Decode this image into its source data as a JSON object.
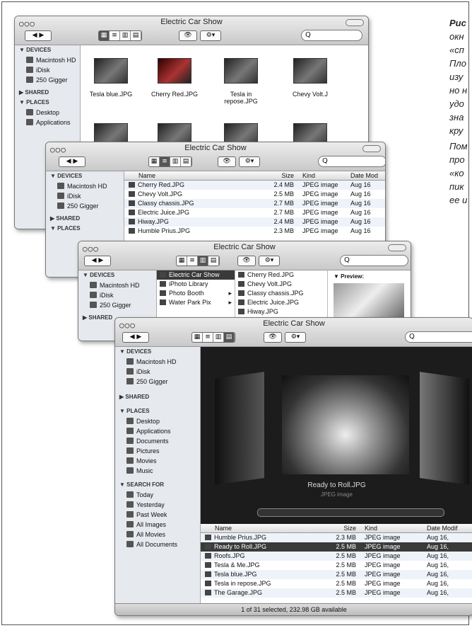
{
  "caption": {
    "lines": [
      "Рис",
      "окн",
      "«сп",
      "Пло",
      "изу",
      "но н",
      "удо",
      "зна",
      "кру",
      "Пом",
      "про",
      "«ко",
      "пик",
      "ее и"
    ]
  },
  "window_title": "Electric Car Show",
  "search_placeholder": "Q",
  "sidebar": {
    "devices_header": "▼ DEVICES",
    "devices": [
      "Macintosh HD",
      "iDisk",
      "250 Gigger"
    ],
    "shared_header": "▶ SHARED",
    "places_header": "▼ PLACES",
    "places": [
      "Desktop",
      "Applications",
      "Documents",
      "Pictures",
      "Movies",
      "Music"
    ],
    "search_header": "▼ SEARCH FOR",
    "searches": [
      "Today",
      "Yesterday",
      "Past Week",
      "All Images",
      "All Movies",
      "All Documents"
    ]
  },
  "icon_view": {
    "items": [
      "Tesla blue.JPG",
      "Cherry Red.JPG",
      "Tesla in repose.JPG",
      "Chevy Volt.J"
    ]
  },
  "list_view": {
    "headers": {
      "name": "Name",
      "size": "Size",
      "kind": "Kind",
      "date": "Date Mod"
    },
    "rows": [
      {
        "name": "Cherry Red.JPG",
        "size": "2.4 MB",
        "kind": "JPEG image",
        "date": "Aug 16"
      },
      {
        "name": "Chevy Volt.JPG",
        "size": "2.5 MB",
        "kind": "JPEG image",
        "date": "Aug 16"
      },
      {
        "name": "Classy chassis.JPG",
        "size": "2.7 MB",
        "kind": "JPEG image",
        "date": "Aug 16"
      },
      {
        "name": "Electric Juice.JPG",
        "size": "2.7 MB",
        "kind": "JPEG image",
        "date": "Aug 16"
      },
      {
        "name": "Hiway.JPG",
        "size": "2.4 MB",
        "kind": "JPEG image",
        "date": "Aug 16"
      },
      {
        "name": "Humble Prius.JPG",
        "size": "2.3 MB",
        "kind": "JPEG image",
        "date": "Aug 16"
      }
    ]
  },
  "column_view": {
    "col1": [
      "Electric Car Show",
      "iPhoto Library",
      "Photo Booth",
      "Water Park Pix"
    ],
    "col2": [
      "Cherry Red.JPG",
      "Chevy Volt.JPG",
      "Classy chassis.JPG",
      "Electric Juice.JPG",
      "Hiway.JPG"
    ],
    "preview_label": "▼ Preview:"
  },
  "coverflow_view": {
    "current_title": "Ready to Roll.JPG",
    "current_sub": "JPEG image",
    "headers": {
      "name": "Name",
      "size": "Size",
      "kind": "Kind",
      "date": "Date Modif"
    },
    "rows": [
      {
        "name": "Humble Prius.JPG",
        "size": "2.3 MB",
        "kind": "JPEG image",
        "date": "Aug 16,",
        "sel": false
      },
      {
        "name": "Ready to Roll.JPG",
        "size": "2.5 MB",
        "kind": "JPEG image",
        "date": "Aug 16,",
        "sel": true
      },
      {
        "name": "Roofs.JPG",
        "size": "2.5 MB",
        "kind": "JPEG image",
        "date": "Aug 16,",
        "sel": false
      },
      {
        "name": "Tesla & Me.JPG",
        "size": "2.5 MB",
        "kind": "JPEG image",
        "date": "Aug 16,",
        "sel": false
      },
      {
        "name": "Tesla blue.JPG",
        "size": "2.5 MB",
        "kind": "JPEG image",
        "date": "Aug 16,",
        "sel": false
      },
      {
        "name": "Tesla in repose.JPG",
        "size": "2.5 MB",
        "kind": "JPEG image",
        "date": "Aug 16,",
        "sel": false
      },
      {
        "name": "The Garage.JPG",
        "size": "2.5 MB",
        "kind": "JPEG image",
        "date": "Aug 16,",
        "sel": false
      }
    ],
    "status": "1 of 31 selected, 232.98 GB available"
  },
  "icons": {
    "back": "◀",
    "forward": "▶",
    "eye": "👁",
    "gear": "⚙▾",
    "traffic": "○○○"
  }
}
